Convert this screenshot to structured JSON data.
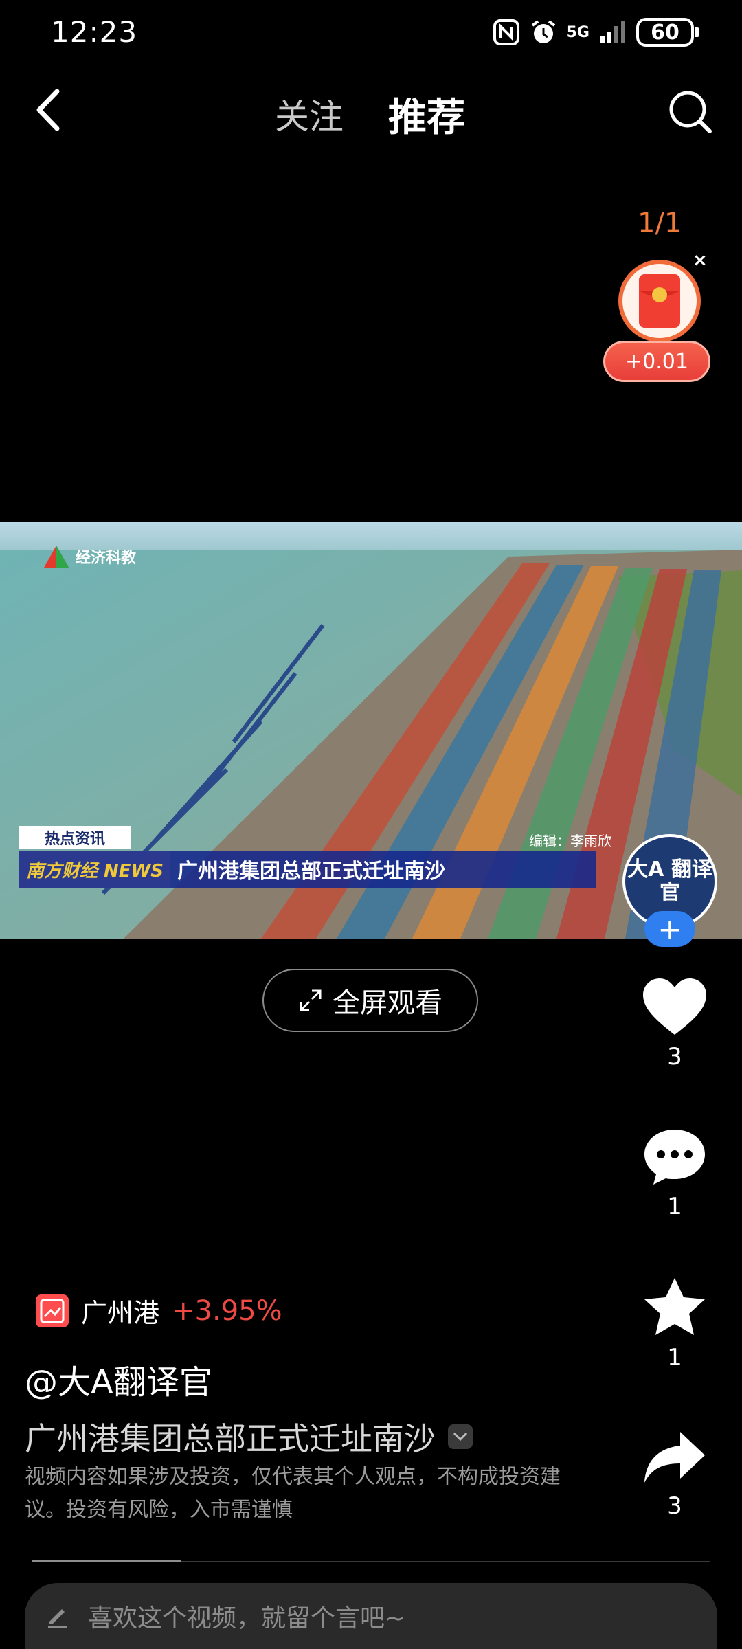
{
  "status_bar": {
    "time": "12:23",
    "network": "5G",
    "battery": "60"
  },
  "header": {
    "tabs": [
      {
        "label": "关注"
      },
      {
        "label": "推荐"
      }
    ]
  },
  "reward": {
    "count": "1/1",
    "close": "×",
    "amount": "+0.01"
  },
  "video": {
    "channel_logo": "经济科教",
    "news_tag": "热点资讯",
    "news_brand": "南方财经 NEWS",
    "headline": "广州港集团总部正式迁址南沙",
    "editor": "编辑：李雨欣",
    "avatar_text": "大A 翻译官",
    "progress": 0.22
  },
  "fullscreen": {
    "label": "全屏观看"
  },
  "actions": {
    "like": {
      "icon": "heart-icon",
      "count": "3"
    },
    "comment": {
      "icon": "comment-icon",
      "count": "1"
    },
    "favorite": {
      "icon": "star-icon",
      "count": "1"
    },
    "share": {
      "icon": "share-icon",
      "count": "3"
    }
  },
  "stock": {
    "name": "广州港",
    "change": "+3.95%",
    "color": "#f04a45"
  },
  "post": {
    "author": "@大A翻译官",
    "title": "广州港集团总部正式迁址南沙",
    "disclaimer": "视频内容如果涉及投资，仅代表其个人观点，不构成投资建议。投资有风险，入市需谨慎"
  },
  "comment_input": {
    "placeholder": "喜欢这个视频，就留个言吧~"
  }
}
